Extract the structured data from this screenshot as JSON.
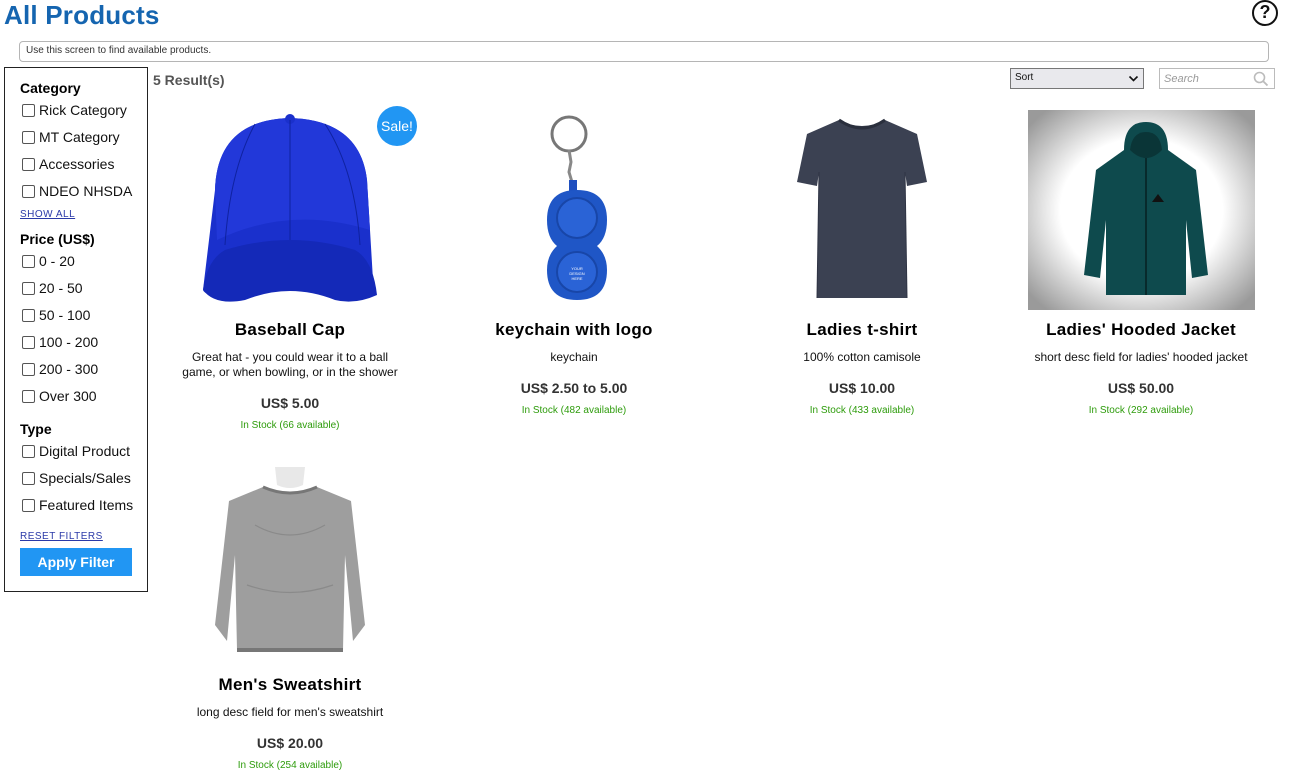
{
  "header": {
    "title": "All Products",
    "help_icon": "question-circle-icon"
  },
  "info_text": "Use this screen to find available products.",
  "filters": {
    "category_heading": "Category",
    "categories": [
      "Rick Category",
      "MT Category",
      "Accessories",
      "NDEO NHSDA"
    ],
    "show_all": "SHOW ALL",
    "price_heading": "Price  (US$)",
    "prices": [
      "0 - 20",
      "20 - 50",
      "50 - 100",
      "100 - 200",
      "200 - 300",
      "Over 300"
    ],
    "type_heading": "Type",
    "types": [
      "Digital Product",
      "Specials/Sales",
      "Featured Items"
    ],
    "reset": "RESET FILTERS",
    "apply": "Apply Filter"
  },
  "results": {
    "count_text": "5 Result(s)",
    "sort_value": "Sort",
    "search_placeholder": "Search"
  },
  "products": [
    {
      "name": "Baseball Cap",
      "desc": "Great hat - you could wear it to a ball game, or when bowling, or in the shower",
      "price": "US$ 5.00",
      "stock": "In Stock (66 available)",
      "badge": "Sale!",
      "image": "blue-baseball-cap"
    },
    {
      "name": "keychain with logo",
      "desc": "keychain",
      "price": "US$ 2.50 to 5.00",
      "stock": "In Stock (482 available)",
      "image": "blue-popper-keychain",
      "image_text": "YOUR DESIGN HERE"
    },
    {
      "name": "Ladies t-shirt",
      "desc": "100% cotton camisole",
      "price": "US$ 10.00",
      "stock": "In Stock (433 available)",
      "image": "navy-t-shirt"
    },
    {
      "name": "Ladies' Hooded Jacket",
      "desc": "short desc field for ladies' hooded jacket",
      "price": "US$ 50.00",
      "stock": "In Stock (292 available)",
      "image": "teal-hooded-jacket"
    },
    {
      "name": "Men's Sweatshirt",
      "desc": "long desc field for men's sweatshirt",
      "price": "US$ 20.00",
      "stock": "In Stock (254 available)",
      "image": "grey-sweatshirt-on-mannequin"
    }
  ],
  "colors": {
    "title": "#1565b0",
    "accent": "#2196f3",
    "stock": "#2e9c0c"
  }
}
